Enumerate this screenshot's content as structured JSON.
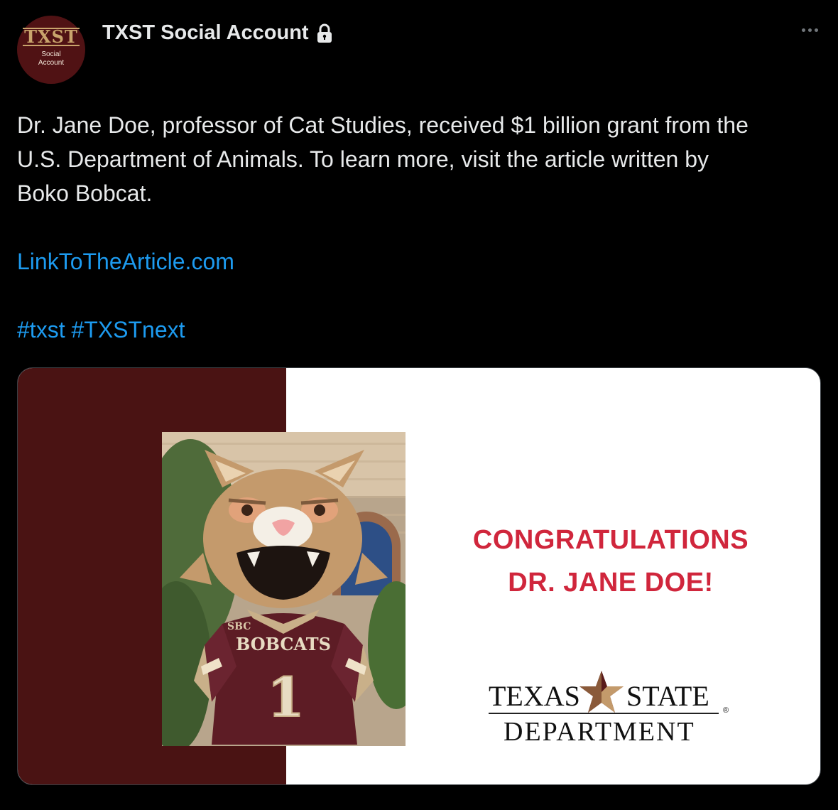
{
  "account": {
    "avatar_monogram": "TXST",
    "avatar_sub_line1": "Social",
    "avatar_sub_line2": "Account",
    "display_name": "TXST Social Account",
    "protected_icon": "lock-icon",
    "more_icon": "more-horizontal-icon"
  },
  "tweet": {
    "line1": "Dr. Jane Doe, professor of Cat Studies, received $1 billion grant from the",
    "line2": "U.S. Department of Animals. To learn more, visit the article written by",
    "line3": "Boko Bobcat.",
    "link": "LinkToTheArticle.com",
    "hashtag1": "#txst",
    "hashtag2": "#TXSTnext"
  },
  "media": {
    "congrats_line1": "CONGRATULATIONS",
    "congrats_line2": "DR. JANE DOE!",
    "logo_word1": "TEXAS",
    "logo_word2": "STATE",
    "logo_word3": "DEPARTMENT",
    "logo_reg": "®",
    "jersey_badge": "SBC",
    "jersey_text": "BOBCATS",
    "jersey_number": "1"
  },
  "colors": {
    "background": "#000000",
    "text": "#e7e9ea",
    "link": "#1d9bf0",
    "maroon": "#501214",
    "congrats_red": "#d0263c"
  }
}
